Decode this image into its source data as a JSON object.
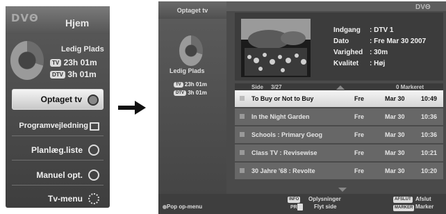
{
  "left_panel": {
    "logo": "DVΘ",
    "home": "Hjem",
    "space_title": "Ledig Plads",
    "tv_tag": "TV",
    "tv_time": "23h 01m",
    "dtv_tag": "DTV",
    "dtv_time": "3h 01m",
    "menu": [
      {
        "label": "Optaget tv",
        "icon": "record-reel-icon"
      },
      {
        "label": "Programvejledning",
        "icon": "guide-grid-icon"
      },
      {
        "label": "Planlæg.liste",
        "icon": "clock-icon"
      },
      {
        "label": "Manuel opt.",
        "icon": "manual-record-icon"
      },
      {
        "label": "Tv-menu",
        "icon": "gears-icon"
      }
    ]
  },
  "right_panel": {
    "tab": "Optaget tv",
    "logo": "DVΘ",
    "sidebar_title": "Ledig Plads",
    "tv_tag": "TV",
    "tv_time": "23h 01m",
    "dtv_tag": "DTV",
    "dtv_time": "3h 01m",
    "info": {
      "input_label": "Indgang",
      "input_value": ": DTV 1",
      "date_label": "Dato",
      "date_value": ": Fre Mar 30 2007",
      "duration_label": "Varighed",
      "duration_value": ": 30m",
      "quality_label": "Kvalitet",
      "quality_value": ": Høj"
    },
    "page_label": "Side",
    "page_value": "3/27",
    "marked": "0 Markeret",
    "recordings": [
      {
        "title": "To Buy or Not to Buy",
        "day": "Fre",
        "date": "Mar 30",
        "time": "10:49",
        "selected": true
      },
      {
        "title": "In the Night Garden",
        "day": "Fre",
        "date": "Mar 30",
        "time": "10:36"
      },
      {
        "title": "Schools : Primary Geog",
        "day": "Fre",
        "date": "Mar 30",
        "time": "10:36"
      },
      {
        "title": "Class TV : Revisewise",
        "day": "Fre",
        "date": "Mar 30",
        "time": "10:21"
      },
      {
        "title": "30 Jahre '68 : Revolte",
        "day": "Fre",
        "date": "Mar 30",
        "time": "10:20"
      }
    ],
    "footer": {
      "popup": "Pop op-menu",
      "info_key": "INFO",
      "info_label": "Oplysninger",
      "pr_key": "PR",
      "pr_label": "Flyt side",
      "exit_key": "AFSLUT",
      "exit_label": "Afslut",
      "mark_key": "MARKER",
      "mark_label": "Marker"
    }
  }
}
